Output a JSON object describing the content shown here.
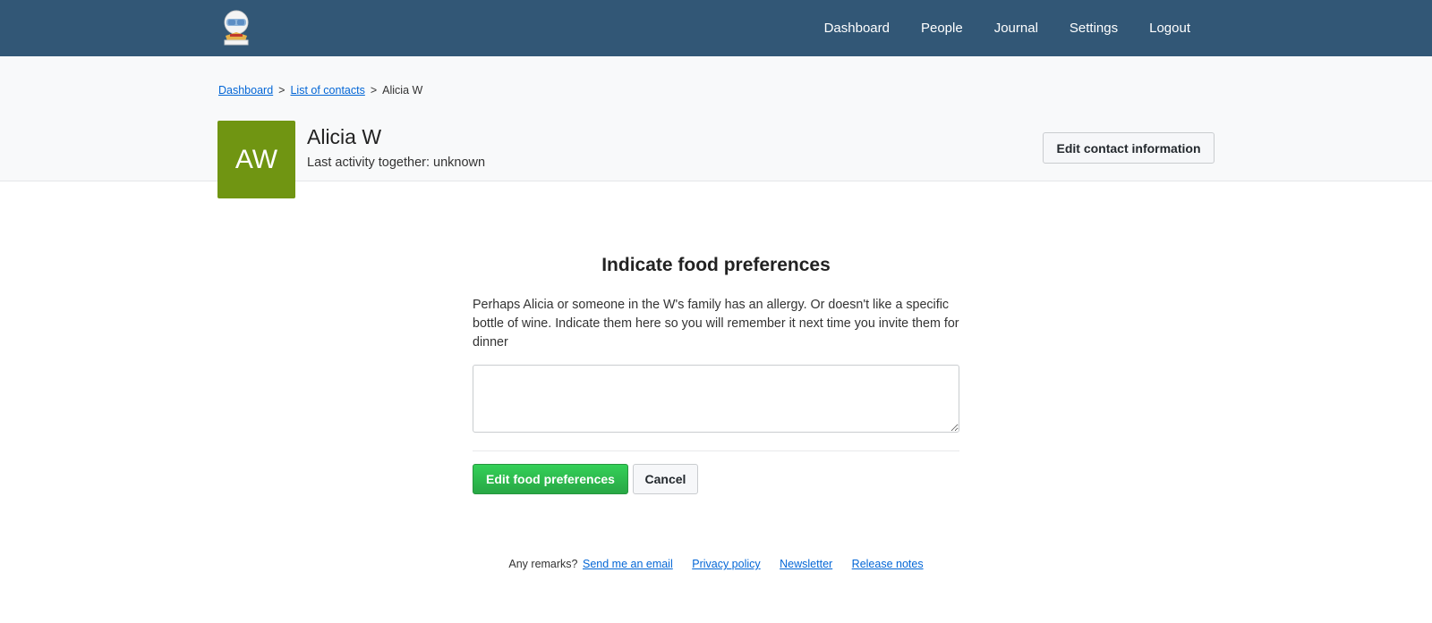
{
  "nav": {
    "logo_icon": "monica-astronaut-logo",
    "items": [
      {
        "label": "Dashboard"
      },
      {
        "label": "People"
      },
      {
        "label": "Journal"
      },
      {
        "label": "Settings"
      },
      {
        "label": "Logout"
      }
    ]
  },
  "breadcrumb": {
    "items": [
      {
        "label": "Dashboard"
      },
      {
        "label": "List of contacts"
      }
    ],
    "separator": ">",
    "current": "Alicia W"
  },
  "contact": {
    "initials": "AW",
    "avatar_color": "#709512",
    "name": "Alicia W",
    "last_activity": "Last activity together: unknown",
    "edit_button_label": "Edit contact information"
  },
  "form": {
    "title": "Indicate food preferences",
    "description": "Perhaps Alicia or someone in the W's family has an allergy. Or doesn't like a specific bottle of wine. Indicate them here so you will remember it next time you invite them for dinner",
    "textarea_value": "",
    "submit_label": "Edit food preferences",
    "cancel_label": "Cancel"
  },
  "footer": {
    "prompt": "Any remarks?",
    "links": [
      {
        "label": "Send me an email"
      },
      {
        "label": "Privacy policy"
      },
      {
        "label": "Newsletter"
      },
      {
        "label": "Release notes"
      }
    ]
  },
  "colors": {
    "topbar": "#325776",
    "primary_button": "#28a745",
    "link": "#0366d6"
  }
}
